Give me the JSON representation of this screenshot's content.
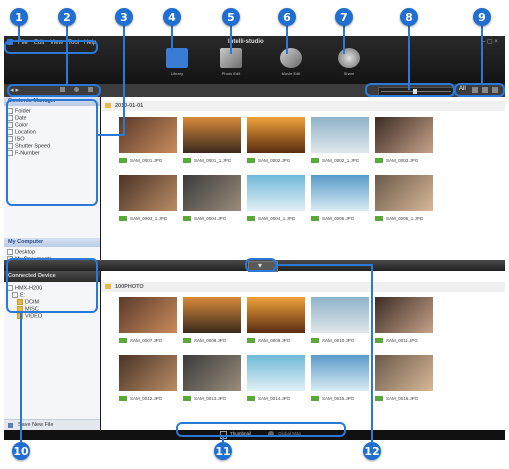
{
  "menu": {
    "items": [
      "File",
      "Edit",
      "View",
      "Tool",
      "Help"
    ],
    "app_title": "Intelli-studio"
  },
  "modes": [
    {
      "label": "Library",
      "icon": "library-icon",
      "color": "#3a7bd5"
    },
    {
      "label": "Photo Edit",
      "icon": "photo-edit-icon",
      "color": "#8a8a8a"
    },
    {
      "label": "Movie Edit",
      "icon": "movie-edit-icon",
      "color": "#8a8a8a"
    },
    {
      "label": "Share",
      "icon": "share-icon",
      "color": "#8a8a8a"
    }
  ],
  "view_buttons": {
    "all_label": "All"
  },
  "contents_manager": {
    "title": "Contents Manager",
    "items": [
      "Folder",
      "Date",
      "Color",
      "Location",
      "ISO",
      "Shutter Speed",
      "F-Number"
    ]
  },
  "my_computer": {
    "title": "My Computer",
    "items": [
      "Desktop",
      "My Documents",
      "C:",
      "E:"
    ]
  },
  "connected_device": {
    "title": "Connected Device",
    "items": [
      "HMX-H200",
      "E:",
      "DCIM",
      "MISC",
      "VIDEO"
    ],
    "save_label": "Save New File"
  },
  "top_folder": {
    "label": "2010-01-01",
    "files": [
      "SAM_0001.JPG",
      "SAM_0001_1.JPG",
      "SAM_0002.JPG",
      "SAM_0002_1.JPG",
      "SAM_0003.JPG",
      "SAM_0003_1.JPG",
      "SAM_0004.JPG",
      "SAM_0004_1.JPG",
      "SAM_0005.JPG",
      "SAM_0005_1.JPG"
    ]
  },
  "bottom_folder": {
    "label": "100PHOTO",
    "files": [
      "SAM_0007.JPG",
      "SAM_0008.JPG",
      "SAM_0009.JPG",
      "SAM_0010.JPG",
      "SAM_0011.JPG",
      "SAM_0012.JPG",
      "SAM_0013.JPG",
      "SAM_0014.JPG",
      "SAM_0015.JPG",
      "SAM_0016.JPG"
    ]
  },
  "bottom_tabs": [
    "Thumbnail",
    "Global Map"
  ],
  "callouts": [
    "1",
    "2",
    "3",
    "4",
    "5",
    "6",
    "7",
    "8",
    "9",
    "10",
    "11",
    "12"
  ],
  "colors": {
    "callout": "#1f6fd0",
    "accent": "#2a78d8"
  }
}
